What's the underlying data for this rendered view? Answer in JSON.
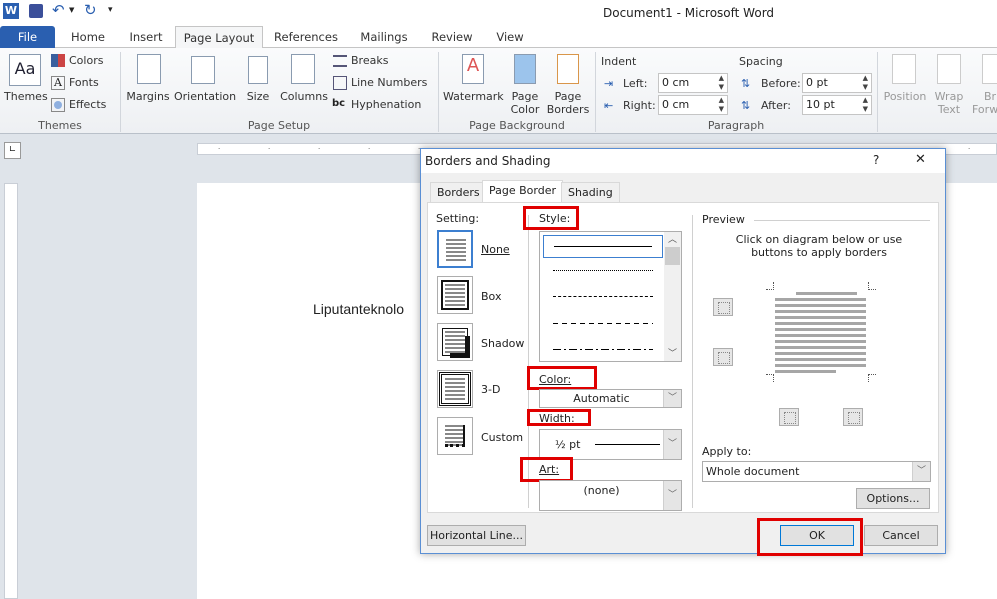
{
  "window": {
    "title": "Document1 - Microsoft Word"
  },
  "qat": {
    "word_icon": "word-logo-icon",
    "save": "save-icon",
    "undo": "undo-icon",
    "redo": "redo-icon",
    "customize": "customize-icon"
  },
  "tabs": [
    {
      "label": "File"
    },
    {
      "label": "Home"
    },
    {
      "label": "Insert"
    },
    {
      "label": "Page Layout",
      "active": true
    },
    {
      "label": "References"
    },
    {
      "label": "Mailings"
    },
    {
      "label": "Review"
    },
    {
      "label": "View"
    }
  ],
  "ribbon": {
    "themes": {
      "themes": "Themes",
      "colors": "Colors",
      "fonts": "Fonts",
      "effects": "Effects",
      "group": "Themes"
    },
    "page_setup": {
      "margins": "Margins",
      "orientation": "Orientation",
      "size": "Size",
      "columns": "Columns",
      "breaks": "Breaks",
      "line_numbers": "Line Numbers",
      "hyphenation": "Hyphenation",
      "group": "Page Setup"
    },
    "page_background": {
      "watermark": "Watermark",
      "page_color_1": "Page",
      "page_color_2": "Color",
      "page_borders_1": "Page",
      "page_borders_2": "Borders",
      "group": "Page Background"
    },
    "paragraph": {
      "indent": "Indent",
      "left_label": "Left:",
      "left_value": "0 cm",
      "right_label": "Right:",
      "right_value": "0 cm",
      "spacing": "Spacing",
      "before_label": "Before:",
      "before_value": "0 pt",
      "after_label": "After:",
      "after_value": "10 pt",
      "group": "Paragraph"
    },
    "arrange": {
      "position": "Position",
      "wrap_1": "Wrap",
      "wrap_2": "Text",
      "bring_1": "Bri",
      "bring_2": "Forw"
    }
  },
  "document": {
    "text": "Liputanteknolo"
  },
  "dialog": {
    "title": "Borders and Shading",
    "help": "?",
    "close": "✕",
    "tabs": [
      {
        "label": "Borders"
      },
      {
        "label": "Page Border",
        "active": true
      },
      {
        "label": "Shading"
      }
    ],
    "setting_label": "Setting:",
    "settings": [
      {
        "label": "None",
        "selected": true
      },
      {
        "label": "Box"
      },
      {
        "label": "Shadow"
      },
      {
        "label": "3-D"
      },
      {
        "label": "Custom"
      }
    ],
    "style_label": "Style:",
    "styles": [
      "solid",
      "dotted",
      "dashed-small",
      "dashed",
      "dash-dot"
    ],
    "color_label": "Color:",
    "color_value": "Automatic",
    "width_label": "Width:",
    "width_value": "½ pt",
    "art_label": "Art:",
    "art_value": "(none)",
    "preview_label": "Preview",
    "preview_hint_1": "Click on diagram below or use",
    "preview_hint_2": "buttons to apply borders",
    "apply_label": "Apply to:",
    "apply_value": "Whole document",
    "options": "Options...",
    "horizontal_line": "Horizontal Line...",
    "ok": "OK",
    "cancel": "Cancel",
    "highlight_color": "#e00000"
  }
}
